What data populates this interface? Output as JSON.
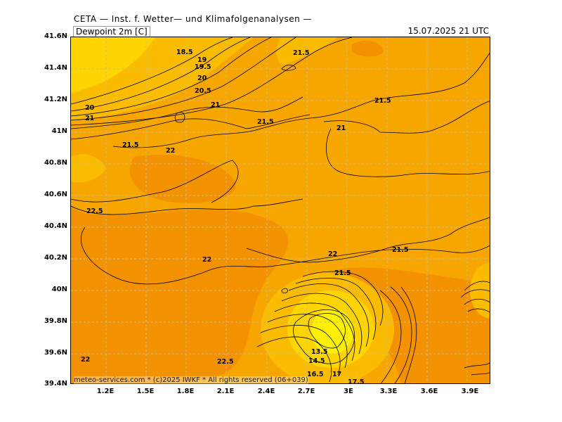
{
  "header": {
    "title": "CETA — Inst. f. Wetter— und Klimafolgenanalysen —",
    "parameter": "Dewpoint 2m [C]",
    "valid_time": "15.07.2025 21 UTC"
  },
  "footer": {
    "credit": "meteo-services.com * (c)2025 IWKF * All rights reserved (06+039)"
  },
  "colors": {
    "dark_orange": "#f39200",
    "mid_orange": "#f7a600",
    "light_orange": "#fbbc00",
    "yellow": "#ffd500",
    "bright_yellow": "#fff200",
    "grid": "#bbbbbb"
  },
  "axes": {
    "y_ticks": [
      "41.6N",
      "41.4N",
      "41.2N",
      "41N",
      "40.8N",
      "40.6N",
      "40.4N",
      "40.2N",
      "40N",
      "39.8N",
      "39.6N",
      "39.4N"
    ],
    "x_ticks": [
      "1.2E",
      "1.5E",
      "1.8E",
      "2.1E",
      "2.4E",
      "2.7E",
      "3E",
      "3.3E",
      "3.6E",
      "3.9E"
    ]
  },
  "contour_labels": [
    {
      "text": "18.5"
    },
    {
      "text": "19"
    },
    {
      "text": "19.5"
    },
    {
      "text": "20"
    },
    {
      "text": "20.5"
    },
    {
      "text": "21"
    },
    {
      "text": "20"
    },
    {
      "text": "21"
    },
    {
      "text": "21.5"
    },
    {
      "text": "22"
    },
    {
      "text": "21.5"
    },
    {
      "text": "21.5"
    },
    {
      "text": "21"
    },
    {
      "text": "21.5"
    },
    {
      "text": "22.5"
    },
    {
      "text": "22"
    },
    {
      "text": "22"
    },
    {
      "text": "21.5"
    },
    {
      "text": "21.5"
    },
    {
      "text": "22"
    },
    {
      "text": "22.5"
    },
    {
      "text": "13.5"
    },
    {
      "text": "14.5"
    },
    {
      "text": "16.5"
    },
    {
      "text": "17"
    },
    {
      "text": "17.5"
    }
  ]
}
